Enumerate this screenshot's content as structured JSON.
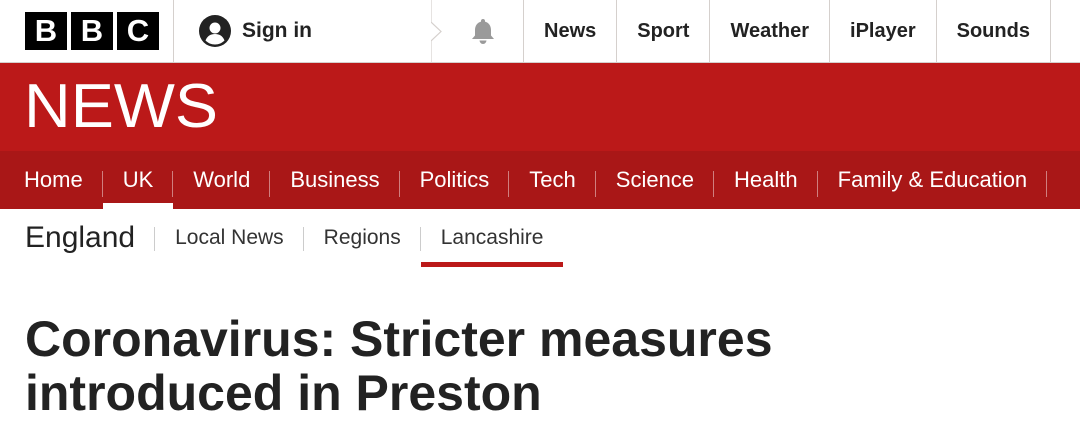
{
  "brand": {
    "letters": [
      "B",
      "B",
      "C"
    ],
    "colors": {
      "banner": "#bb1919",
      "section_nav": "#a91717",
      "accent": "#bb1919"
    }
  },
  "account": {
    "signin_label": "Sign in",
    "icon": "user-icon"
  },
  "notifications": {
    "icon": "bell-icon"
  },
  "top_nav": [
    {
      "label": "News"
    },
    {
      "label": "Sport"
    },
    {
      "label": "Weather"
    },
    {
      "label": "iPlayer"
    },
    {
      "label": "Sounds"
    }
  ],
  "banner": {
    "wordmark": "NEWS"
  },
  "section_nav": [
    {
      "label": "Home",
      "active": false
    },
    {
      "label": "UK",
      "active": true
    },
    {
      "label": "World",
      "active": false
    },
    {
      "label": "Business",
      "active": false
    },
    {
      "label": "Politics",
      "active": false
    },
    {
      "label": "Tech",
      "active": false
    },
    {
      "label": "Science",
      "active": false
    },
    {
      "label": "Health",
      "active": false
    },
    {
      "label": "Family & Education",
      "active": false
    }
  ],
  "sub_nav": {
    "title": "England",
    "items": [
      {
        "label": "Local News",
        "active": false
      },
      {
        "label": "Regions",
        "active": false
      },
      {
        "label": "Lancashire",
        "active": true
      }
    ]
  },
  "article": {
    "headline": "Coronavirus: Stricter measures introduced in Preston"
  }
}
